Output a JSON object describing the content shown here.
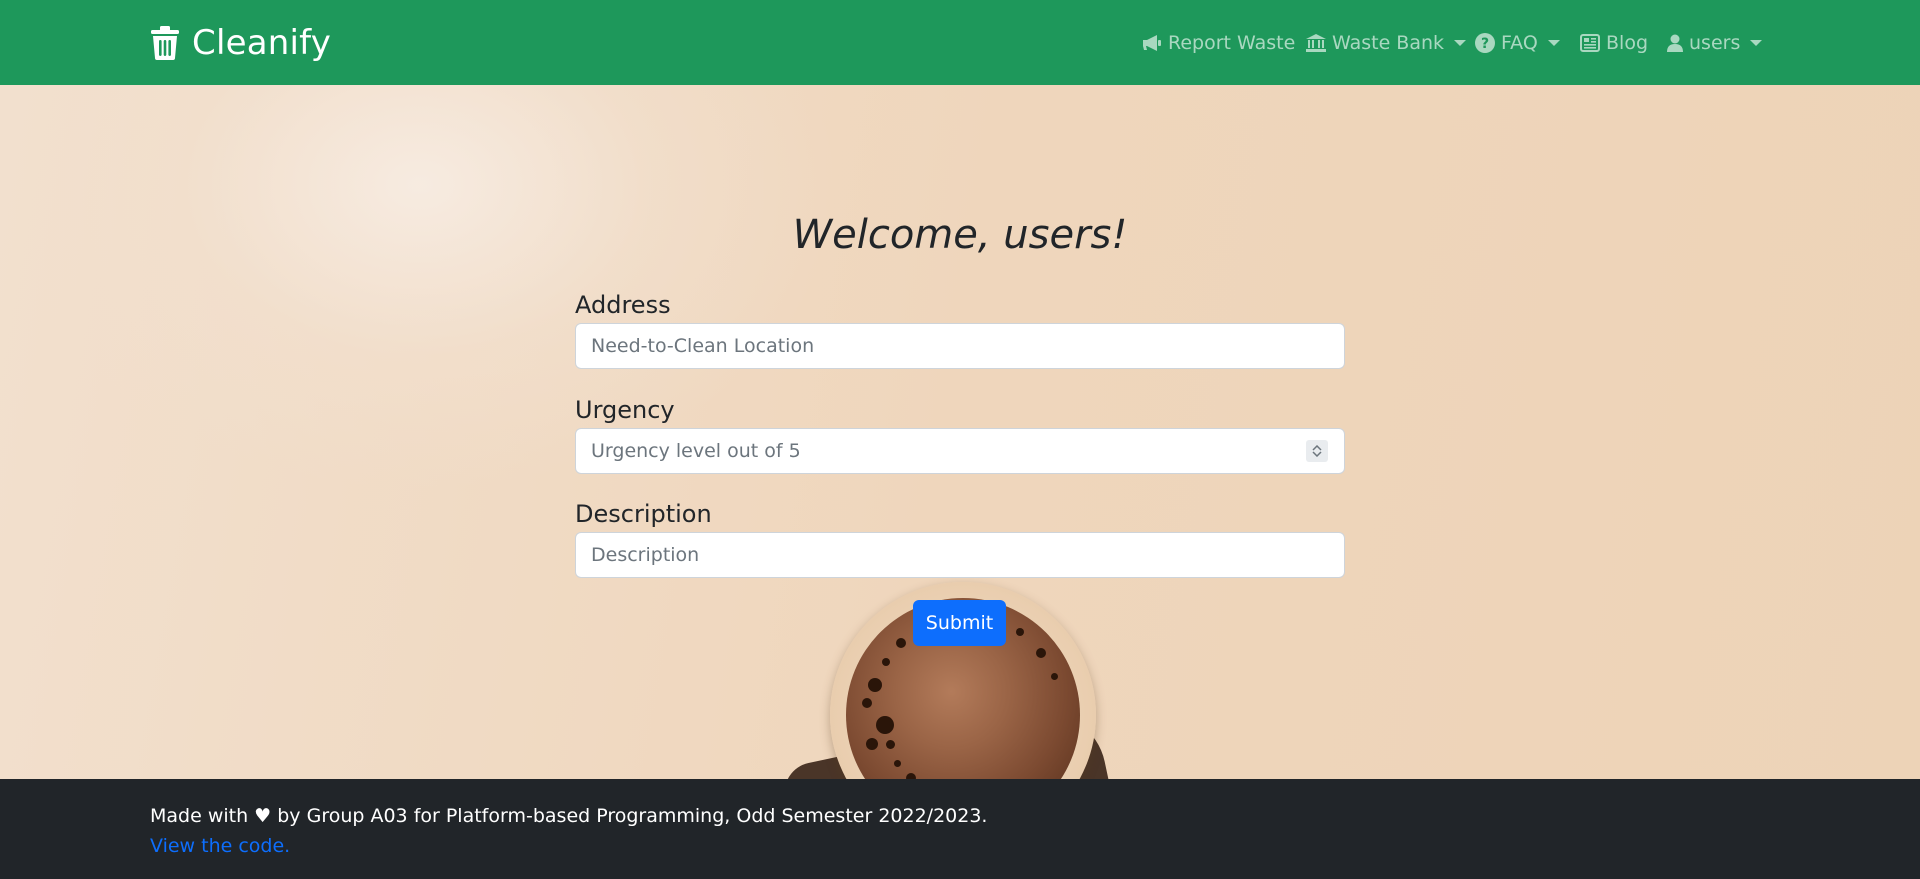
{
  "brand": {
    "name": "Cleanify",
    "icon": "trash-icon"
  },
  "nav": {
    "report_waste": "Report Waste",
    "waste_bank": "Waste Bank",
    "faq": "FAQ",
    "blog": "Blog",
    "user": "users"
  },
  "main": {
    "title": "Welcome, users!",
    "address_label": "Address",
    "address_placeholder": "Need-to-Clean Location",
    "urgency_label": "Urgency",
    "urgency_placeholder": "Urgency level out of 5",
    "description_label": "Description",
    "description_placeholder": "Description",
    "submit_label": "Submit"
  },
  "footer": {
    "text": "Made with ♥ by Group A03 for Platform-based Programming, Odd Semester 2022/2023.",
    "link": "View the code."
  },
  "colors": {
    "navbar": "#1e985b",
    "footer": "#212529",
    "primary": "#0d6efd"
  }
}
